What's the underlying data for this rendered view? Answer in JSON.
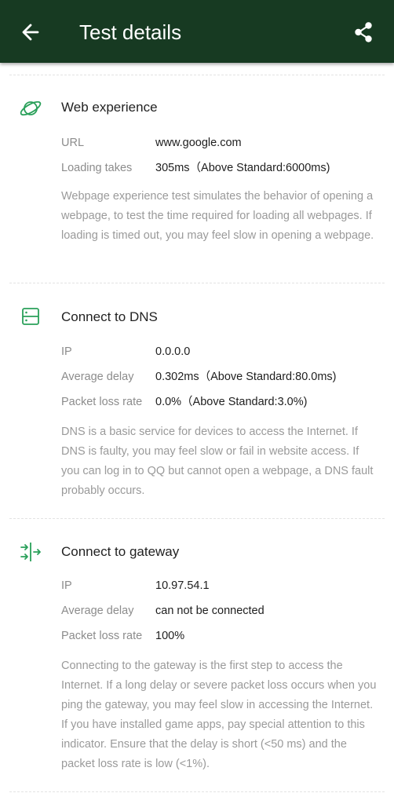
{
  "header": {
    "title": "Test details"
  },
  "icons": {
    "back": "arrow-left",
    "share": "share",
    "web": "planet",
    "dns": "server",
    "gateway": "arrows-split"
  },
  "colors": {
    "appbar": "#173a22",
    "accent": "#2aa05a",
    "label": "#8c8c8c",
    "value": "#1e1e1e",
    "description": "#9a9a9a"
  },
  "sections": {
    "web": {
      "title": "Web experience",
      "rows": [
        {
          "label": "URL",
          "value": "www.google.com"
        },
        {
          "label": "Loading takes",
          "value": "305ms（Above Standard:6000ms)"
        }
      ],
      "description": "Webpage experience test simulates the behavior of opening a webpage, to test the time required for loading all webpages. If loading is timed out, you may feel slow in opening a webpage."
    },
    "dns": {
      "title": "Connect to DNS",
      "rows": [
        {
          "label": "IP",
          "value": "0.0.0.0"
        },
        {
          "label": "Average delay",
          "value": "0.302ms（Above Standard:80.0ms)"
        },
        {
          "label": "Packet loss rate",
          "value": "0.0%（Above Standard:3.0%)"
        }
      ],
      "description": "DNS is a basic service for devices to access the Internet. If DNS is faulty, you may feel slow or fail in website access. If you can log in to QQ but cannot open a webpage, a DNS fault probably occurs."
    },
    "gateway": {
      "title": "Connect to gateway",
      "rows": [
        {
          "label": "IP",
          "value": "10.97.54.1"
        },
        {
          "label": "Average delay",
          "value": "can not be connected"
        },
        {
          "label": "Packet loss rate",
          "value": "100%"
        }
      ],
      "description": "Connecting to the gateway is the first step to access the Internet. If a long delay or severe packet loss occurs when you ping the gateway, you may feel slow in accessing the Internet. If you have installed game apps, pay special attention to this indicator. Ensure that the delay is short (<50 ms) and the packet loss rate is low (<1%)."
    }
  }
}
